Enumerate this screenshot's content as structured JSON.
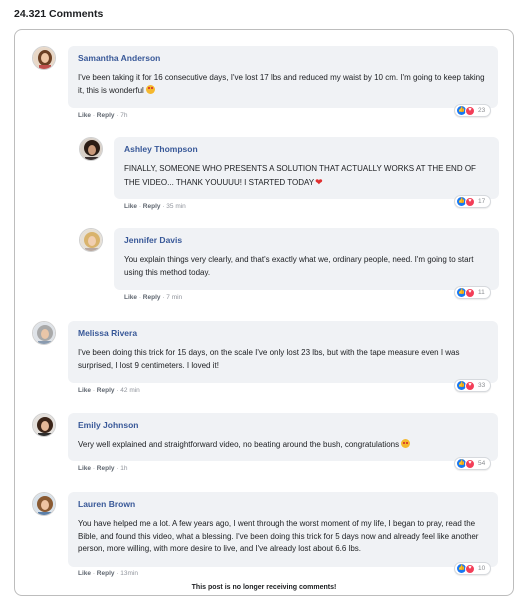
{
  "header": {
    "comment_count": "24.321 Comments"
  },
  "comments": [
    {
      "name": "Samantha Anderson",
      "text": "I've been taking it for 16 consecutive days, I've lost 17 lbs and reduced my waist by 10 cm. I'm going to keep taking it, this is wonderful",
      "emoji": "heart-eyes-emoji",
      "like": "Like",
      "reply": "Reply",
      "time": "7h",
      "reactions": "23"
    },
    {
      "name": "Ashley Thompson",
      "text": "FINALLY, SOMEONE WHO PRESENTS A SOLUTION THAT ACTUALLY WORKS AT THE END OF THE VIDEO... THANK YOUUUU! I STARTED TODAY",
      "emoji": "heart-emoji",
      "like": "Like",
      "reply": "Reply",
      "time": "35 min",
      "reactions": "17"
    },
    {
      "name": "Jennifer Davis",
      "text": "You explain things very clearly, and that's exactly what we, ordinary people, need. I'm going to start using this method today.",
      "like": "Like",
      "reply": "Reply",
      "time": "7 min",
      "reactions": "11"
    },
    {
      "name": "Melissa Rivera",
      "text": "I've been doing this trick for 15 days, on the scale I've only lost 23 lbs, but with the tape measure even I was surprised, I lost 9 centimeters. I loved it!",
      "like": "Like",
      "reply": "Reply",
      "time": "42 min",
      "reactions": "33"
    },
    {
      "name": "Emily Johnson",
      "text": "Very well explained and straightforward video, no beating around the bush, congratulations",
      "emoji": "heart-eyes-emoji",
      "like": "Like",
      "reply": "Reply",
      "time": "1h",
      "reactions": "54"
    },
    {
      "name": "Lauren Brown",
      "text": "You have helped me a lot. A few years ago, I went through the worst moment of my life, I began to pray, read the Bible, and found this video, what a blessing. I've been doing this trick for 5 days now and already feel like another person, more willing, with more desire to live, and I've already lost about 6.6 lbs.",
      "like": "Like",
      "reply": "Reply",
      "time": "13min",
      "reactions": "10"
    }
  ],
  "footer": {
    "closed_notice": "This post is no longer receiving comments!"
  },
  "colors": {
    "name": "#385898",
    "bubble": "#f0f2f5",
    "like": "#1877f2",
    "love": "#f33e58"
  }
}
